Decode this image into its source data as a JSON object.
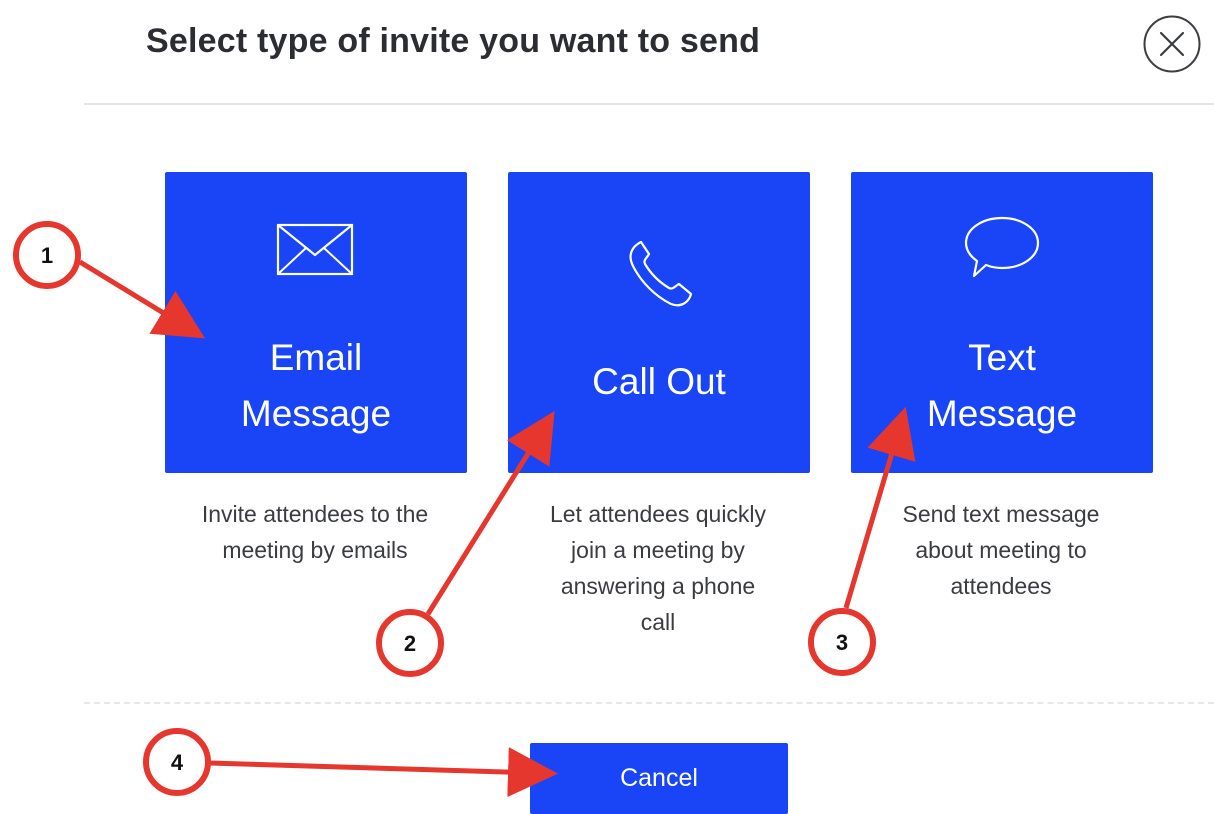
{
  "dialog": {
    "title": "Select type of invite you want to send",
    "close_icon": "close-circle-icon"
  },
  "options": [
    {
      "id": "email",
      "icon": "envelope-icon",
      "label_lines": [
        "Email",
        "Message"
      ],
      "description_lines": [
        "Invite attendees to the",
        "meeting by emails"
      ]
    },
    {
      "id": "callout",
      "icon": "phone-icon",
      "label_lines": [
        "Call Out"
      ],
      "description_lines": [
        "Let attendees quickly",
        "join a meeting by",
        "answering a phone",
        "call"
      ]
    },
    {
      "id": "text",
      "icon": "speech-bubble-icon",
      "label_lines": [
        "Text",
        "Message"
      ],
      "description_lines": [
        "Send text message",
        "about meeting to",
        "attendees"
      ]
    }
  ],
  "footer": {
    "cancel_label": "Cancel"
  },
  "annotations": {
    "markers": [
      "1",
      "2",
      "3",
      "4"
    ]
  },
  "colors": {
    "accent": "#1a45f6",
    "annotation": "#e5372d",
    "title_text": "#2b2d33",
    "body_text": "#3a3c42"
  }
}
